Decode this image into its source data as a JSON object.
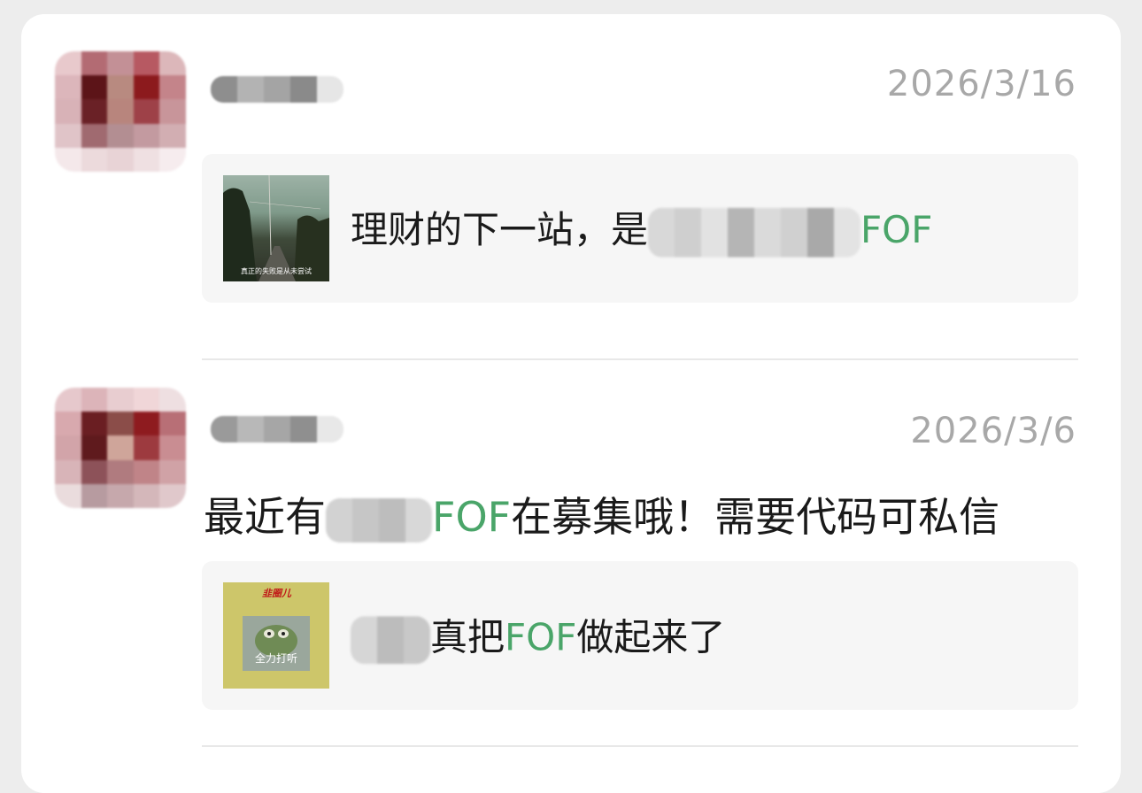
{
  "posts": [
    {
      "date": "2026/3/16",
      "link": {
        "title_prefix": "理财的下一站，是",
        "title_suffix": "FOF",
        "thumb_caption": "真正的失败是从未尝试"
      }
    },
    {
      "date": "2026/3/6",
      "text_prefix": "最近有",
      "text_green": "FOF",
      "text_suffix": "在募集哦！需要代码可私信",
      "link": {
        "title_green": "FOF",
        "title_prefix": "真把",
        "title_suffix": "做起来了",
        "thumb_logo": "韭圈儿",
        "thumb_caption": "全力打听"
      }
    }
  ],
  "colors": {
    "accent_green": "#4aa569",
    "date_gray": "#a8a8a8",
    "card_bg": "#f6f6f6"
  }
}
